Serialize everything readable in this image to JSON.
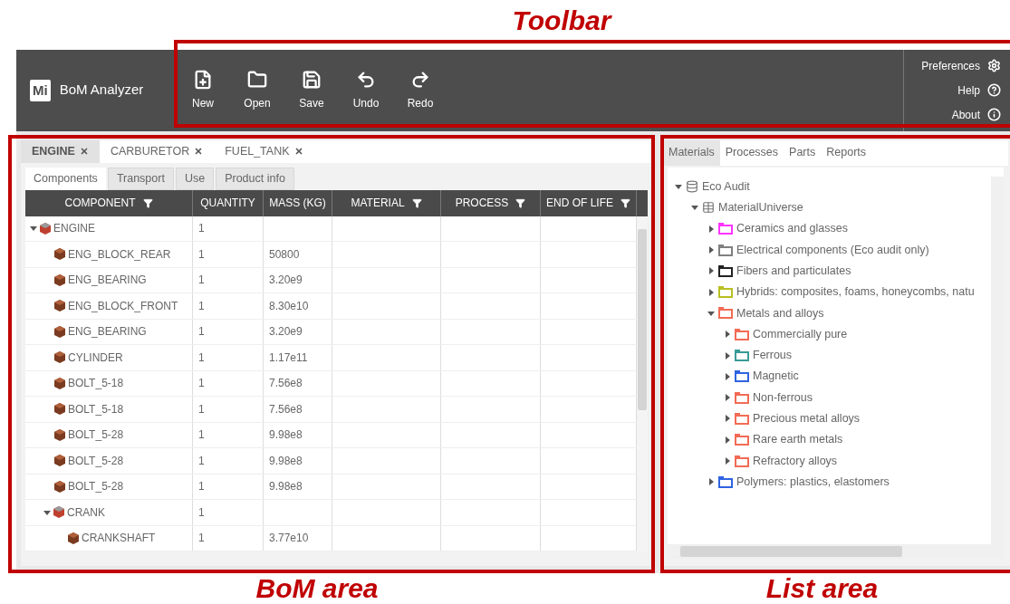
{
  "annotations": [
    {
      "kind": "toolbar",
      "label": "Toolbar"
    },
    {
      "kind": "bom",
      "label": "BoM area"
    },
    {
      "kind": "list",
      "label": "List area"
    }
  ],
  "app": {
    "logo": "Mi",
    "title": "BoM Analyzer"
  },
  "toolbar": [
    {
      "kind": "new",
      "label": "New"
    },
    {
      "kind": "open",
      "label": "Open"
    },
    {
      "kind": "save",
      "label": "Save"
    },
    {
      "kind": "undo",
      "label": "Undo"
    },
    {
      "kind": "redo",
      "label": "Redo"
    }
  ],
  "side_menu": [
    {
      "kind": "preferences",
      "label": "Preferences"
    },
    {
      "kind": "help",
      "label": "Help"
    },
    {
      "kind": "about",
      "label": "About"
    }
  ],
  "document_tabs": [
    {
      "label": "ENGINE",
      "selected": true
    },
    {
      "label": "CARBURETOR",
      "selected": false
    },
    {
      "label": "FUEL_TANK",
      "selected": false
    }
  ],
  "view_tabs": [
    {
      "label": "Components",
      "selected": true
    },
    {
      "label": "Transport",
      "selected": false
    },
    {
      "label": "Use",
      "selected": false
    },
    {
      "label": "Product info",
      "selected": false
    }
  ],
  "table": {
    "columns": [
      {
        "label": "COMPONENT",
        "filter": true
      },
      {
        "label": "QUANTITY",
        "filter": false
      },
      {
        "label": "MASS (KG)",
        "filter": false
      },
      {
        "label": "MATERIAL",
        "filter": true
      },
      {
        "label": "PROCESS",
        "filter": true
      },
      {
        "label": "END OF LIFE",
        "filter": true
      }
    ],
    "rows": [
      {
        "kind": "assembly",
        "name": "ENGINE",
        "quantity": "1",
        "expanded": true,
        "children": [
          {
            "kind": "part",
            "name": "ENG_BLOCK_REAR",
            "quantity": "1",
            "mass": "50800"
          },
          {
            "kind": "part",
            "name": "ENG_BEARING",
            "quantity": "1",
            "mass": "3.20e9"
          },
          {
            "kind": "part",
            "name": "ENG_BLOCK_FRONT",
            "quantity": "1",
            "mass": "8.30e10"
          },
          {
            "kind": "part",
            "name": "ENG_BEARING",
            "quantity": "1",
            "mass": "3.20e9"
          },
          {
            "kind": "part",
            "name": "CYLINDER",
            "quantity": "1",
            "mass": "1.17e11"
          },
          {
            "kind": "part",
            "name": "BOLT_5-18",
            "quantity": "1",
            "mass": "7.56e8"
          },
          {
            "kind": "part",
            "name": "BOLT_5-18",
            "quantity": "1",
            "mass": "7.56e8"
          },
          {
            "kind": "part",
            "name": "BOLT_5-28",
            "quantity": "1",
            "mass": "9.98e8"
          },
          {
            "kind": "part",
            "name": "BOLT_5-28",
            "quantity": "1",
            "mass": "9.98e8"
          },
          {
            "kind": "part",
            "name": "BOLT_5-28",
            "quantity": "1",
            "mass": "9.98e8"
          },
          {
            "kind": "assembly",
            "name": "CRANK",
            "quantity": "1",
            "expanded": true,
            "children": [
              {
                "kind": "part",
                "name": "CRANKSHAFT",
                "quantity": "1",
                "mass": "3.77e10"
              }
            ]
          }
        ]
      }
    ]
  },
  "list_tabs": [
    {
      "label": "Materials",
      "selected": true
    },
    {
      "label": "Processes",
      "selected": false
    },
    {
      "label": "Parts",
      "selected": false
    },
    {
      "label": "Reports",
      "selected": false
    }
  ],
  "tree": [
    {
      "kind": "database",
      "label": "Eco Audit",
      "expanded": true,
      "children": [
        {
          "kind": "table",
          "label": "MaterialUniverse",
          "expanded": true,
          "children": [
            {
              "kind": "folder",
              "label": "Ceramics and glasses",
              "color": "#ff33ff",
              "expanded": false
            },
            {
              "kind": "folder",
              "label": "Electrical components (Eco audit only)",
              "color": "#808080",
              "expanded": false
            },
            {
              "kind": "folder",
              "label": "Fibers and particulates",
              "color": "#222222",
              "expanded": false
            },
            {
              "kind": "folder",
              "label": "Hybrids: composites, foams, honeycombs, natu",
              "color": "#b8bf22",
              "expanded": false
            },
            {
              "kind": "folder",
              "label": "Metals and alloys",
              "color": "#f26b55",
              "expanded": true,
              "children": [
                {
                  "kind": "folder",
                  "label": "Commercially pure",
                  "color": "#f26b55",
                  "expanded": false
                },
                {
                  "kind": "folder",
                  "label": "Ferrous",
                  "color": "#3a9a96",
                  "expanded": false
                },
                {
                  "kind": "folder",
                  "label": "Magnetic",
                  "color": "#2f63e0",
                  "expanded": false
                },
                {
                  "kind": "folder",
                  "label": "Non-ferrous",
                  "color": "#f26b55",
                  "expanded": false
                },
                {
                  "kind": "folder",
                  "label": "Precious metal alloys",
                  "color": "#f26b55",
                  "expanded": false
                },
                {
                  "kind": "folder",
                  "label": "Rare earth metals",
                  "color": "#f26b55",
                  "expanded": false
                },
                {
                  "kind": "folder",
                  "label": "Refractory alloys",
                  "color": "#f26b55",
                  "expanded": false
                }
              ]
            },
            {
              "kind": "folder",
              "label": "Polymers: plastics, elastomers",
              "color": "#2f63e0",
              "expanded": false
            }
          ]
        }
      ]
    }
  ]
}
